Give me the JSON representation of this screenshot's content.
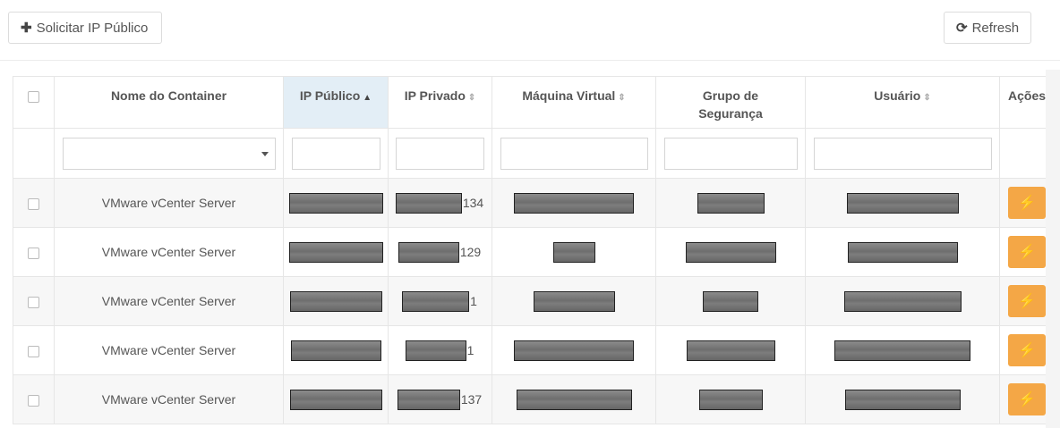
{
  "toolbar": {
    "request_label": "Solicitar IP Público",
    "request_icon": "plus-icon",
    "refresh_label": "Refresh",
    "refresh_icon": "refresh-icon"
  },
  "table": {
    "columns": [
      {
        "label": "",
        "sortable": false
      },
      {
        "label": "Nome do Container",
        "sortable": false
      },
      {
        "label": "IP Público",
        "sortable": true,
        "sort": "asc"
      },
      {
        "label": "IP Privado",
        "sortable": true
      },
      {
        "label": "Máquina Virtual",
        "sortable": true
      },
      {
        "label": "Grupo de Segurança",
        "sortable": false
      },
      {
        "label": "Usuário",
        "sortable": true
      },
      {
        "label": "Ações",
        "sortable": false
      }
    ],
    "rows": [
      {
        "name": "VMware vCenter Server",
        "ip_privado_suffix": "134"
      },
      {
        "name": "VMware vCenter Server",
        "ip_privado_suffix": "129"
      },
      {
        "name": "VMware vCenter Server",
        "ip_privado_suffix": "1"
      },
      {
        "name": "VMware vCenter Server",
        "ip_privado_suffix": "1"
      },
      {
        "name": "VMware vCenter Server",
        "ip_privado_suffix": "137"
      }
    ],
    "action_icon": "plug-icon"
  },
  "colors": {
    "accent_orange": "#f4a746",
    "sorted_header_bg": "#e3eef6",
    "row_alt_bg": "#f7f7f7"
  }
}
